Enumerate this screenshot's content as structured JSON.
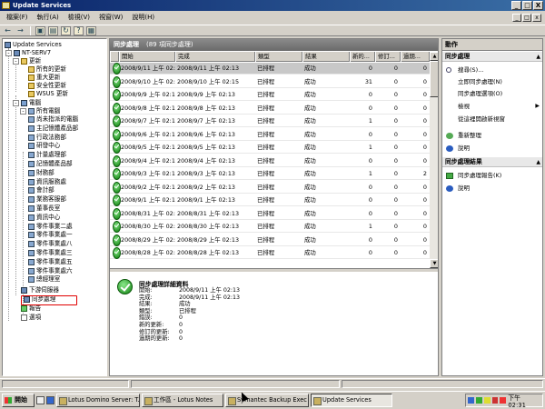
{
  "window": {
    "title": "Update Services",
    "minimize": "_",
    "maximize": "□",
    "close": "X"
  },
  "menu": [
    "檔案(F)",
    "執行(A)",
    "檢視(V)",
    "視窗(W)",
    "說明(H)"
  ],
  "tree": {
    "root": "Update Services",
    "server": "NT-SERV7",
    "updates": "更新",
    "updates_children": [
      "所有的更新",
      "重大更新",
      "安全性更新",
      "WSUS 更新"
    ],
    "computers": "電腦",
    "all_computers": "所有電腦",
    "groups": [
      "尚未指派的電腦",
      "主記憶體產品部",
      "行政法務部",
      "研發中心",
      "計量處理部",
      "記憶體產品部",
      "財務部",
      "資訊服務處",
      "會計部",
      "業務客服部",
      "董事長室",
      "資訊中心",
      "零件事業二處",
      "零件事業處一",
      "零件事業處八",
      "零件事業處三",
      "零件事業處五",
      "零件事業處六",
      "總經理室"
    ],
    "downstream": "下游伺服器",
    "sync": "同步處理",
    "reports": "報告",
    "options": "選項"
  },
  "list": {
    "title": "同步處理",
    "count": "(89 項同步處理)",
    "columns": [
      "開始",
      "完成",
      "類型",
      "結果",
      "新的...",
      "修訂...",
      "過期..."
    ],
    "rows": [
      {
        "start": "2008/9/11 上午 02:13",
        "end": "2008/9/11 上午 02:13",
        "type": "已排程",
        "result": "成功",
        "new": "0",
        "rev": "0",
        "exp": "0"
      },
      {
        "start": "2008/9/10 上午 02:13",
        "end": "2008/9/10 上午 02:15",
        "type": "已排程",
        "result": "成功",
        "new": "31",
        "rev": "0",
        "exp": "0"
      },
      {
        "start": "2008/9/9 上午 02:13",
        "end": "2008/9/9 上午 02:13",
        "type": "已排程",
        "result": "成功",
        "new": "0",
        "rev": "0",
        "exp": "0"
      },
      {
        "start": "2008/9/8 上午 02:13",
        "end": "2008/9/8 上午 02:13",
        "type": "已排程",
        "result": "成功",
        "new": "0",
        "rev": "0",
        "exp": "0"
      },
      {
        "start": "2008/9/7 上午 02:13",
        "end": "2008/9/7 上午 02:13",
        "type": "已排程",
        "result": "成功",
        "new": "1",
        "rev": "0",
        "exp": "0"
      },
      {
        "start": "2008/9/6 上午 02:13",
        "end": "2008/9/6 上午 02:13",
        "type": "已排程",
        "result": "成功",
        "new": "0",
        "rev": "0",
        "exp": "0"
      },
      {
        "start": "2008/9/5 上午 02:13",
        "end": "2008/9/5 上午 02:13",
        "type": "已排程",
        "result": "成功",
        "new": "1",
        "rev": "0",
        "exp": "0"
      },
      {
        "start": "2008/9/4 上午 02:13",
        "end": "2008/9/4 上午 02:13",
        "type": "已排程",
        "result": "成功",
        "new": "0",
        "rev": "0",
        "exp": "0"
      },
      {
        "start": "2008/9/3 上午 02:13",
        "end": "2008/9/3 上午 02:13",
        "type": "已排程",
        "result": "成功",
        "new": "1",
        "rev": "0",
        "exp": "2"
      },
      {
        "start": "2008/9/2 上午 02:13",
        "end": "2008/9/2 上午 02:13",
        "type": "已排程",
        "result": "成功",
        "new": "0",
        "rev": "0",
        "exp": "0"
      },
      {
        "start": "2008/9/1 上午 02:13",
        "end": "2008/9/1 上午 02:13",
        "type": "已排程",
        "result": "成功",
        "new": "0",
        "rev": "0",
        "exp": "0"
      },
      {
        "start": "2008/8/31 上午 02:13",
        "end": "2008/8/31 上午 02:13",
        "type": "已排程",
        "result": "成功",
        "new": "0",
        "rev": "0",
        "exp": "0"
      },
      {
        "start": "2008/8/30 上午 02:13",
        "end": "2008/8/30 上午 02:13",
        "type": "已排程",
        "result": "成功",
        "new": "1",
        "rev": "0",
        "exp": "0"
      },
      {
        "start": "2008/8/29 上午 02:13",
        "end": "2008/8/29 上午 02:13",
        "type": "已排程",
        "result": "成功",
        "new": "0",
        "rev": "0",
        "exp": "0"
      },
      {
        "start": "2008/8/28 上午 02:13",
        "end": "2008/8/28 上午 02:13",
        "type": "已排程",
        "result": "成功",
        "new": "0",
        "rev": "0",
        "exp": "0"
      }
    ]
  },
  "detail": {
    "title": "同步處理詳細資料",
    "fields": [
      {
        "label": "開始:",
        "value": "2008/9/11 上午 02:13"
      },
      {
        "label": "完成:",
        "value": "2008/9/11 上午 02:13"
      },
      {
        "label": "結果:",
        "value": "成功"
      },
      {
        "label": "類型:",
        "value": "已排程"
      },
      {
        "label": "錯誤:",
        "value": "0"
      },
      {
        "label": "新的更新:",
        "value": "0"
      },
      {
        "label": "修訂的更新:",
        "value": "0"
      },
      {
        "label": "過期的更新:",
        "value": "0"
      }
    ]
  },
  "actions": {
    "header": "動作",
    "section1": "同步處理",
    "items1": [
      "搜尋(S)...",
      "立即同步處理(N)",
      "同步處理選項(O)",
      "檢視",
      "從這裡開啟新視窗",
      "重新整理",
      "說明"
    ],
    "section2": "同步處理結果",
    "items2": [
      "同步處理報告(K)",
      "說明"
    ]
  },
  "taskbar": {
    "start": "開始",
    "tasks": [
      "Lotus Domino Server: T...",
      "工作區 - Lotus Notes",
      "Symantec Backup Exec -...",
      "Update Services"
    ],
    "clock": "下午 02:31"
  }
}
